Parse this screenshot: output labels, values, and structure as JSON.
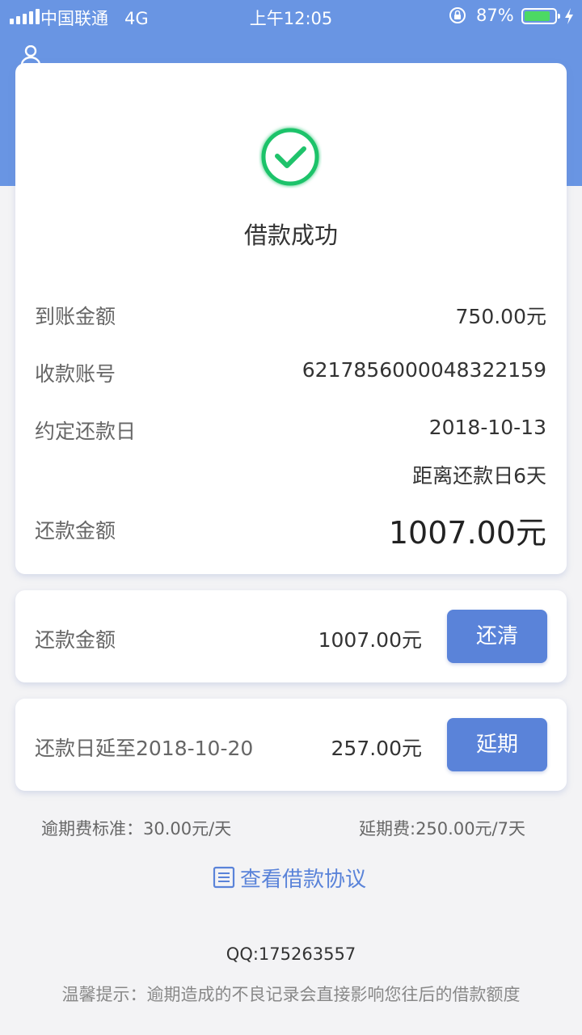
{
  "status_bar": {
    "carrier": "中国联通",
    "network": "4G",
    "time": "上午12:05",
    "battery_percent": "87%",
    "battery_level": 0.87
  },
  "success": {
    "title": "借款成功"
  },
  "details": {
    "received_label": "到账金额",
    "received_value": "750.00元",
    "account_label": "收款账号",
    "account_value": "6217856000048322159",
    "due_label": "约定还款日",
    "due_value": "2018-10-13",
    "due_remaining": "距离还款日6天",
    "repay_label": "还款金额",
    "repay_value": "1007.00元"
  },
  "repay_card": {
    "label": "还款金额",
    "amount": "1007.00元",
    "button": "还清"
  },
  "extend_card": {
    "label": "还款日延至2018-10-20",
    "amount": "257.00元",
    "button": "延期"
  },
  "fees": {
    "overdue": "逾期费标准：30.00元/天",
    "extension": "延期费:250.00元/7天"
  },
  "agreement_link": "查看借款协议",
  "qq": "QQ:175263557",
  "tip": "温馨提示：逾期造成的不良记录会直接影响您往后的借款额度",
  "colors": {
    "header": "#6995e3",
    "accent": "#5a83d9",
    "success": "#1fc36b",
    "background": "#f3f3f5"
  }
}
